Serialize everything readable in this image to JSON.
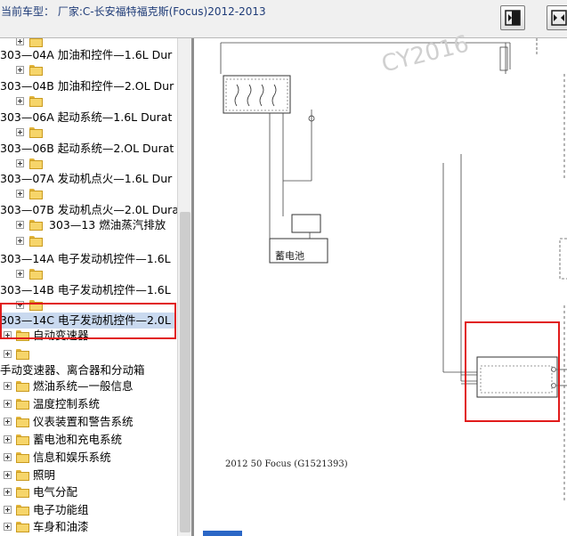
{
  "window": {
    "title": "当前车型：  厂家:C-长安福特福克斯(Focus)2012-2013"
  },
  "toolbar": {
    "buttons": [
      {
        "icon": "panel-right-icon"
      },
      {
        "icon": "panel-expand-icon"
      }
    ]
  },
  "tree": {
    "items": [
      {
        "text": "303—04A 加油和控件—1.6L Dur"
      },
      {
        "text": "303—04B 加油和控件—2.OL Dur"
      },
      {
        "text": "303—06A 起动系统—1.6L Durat"
      },
      {
        "text": "303—06B 起动系统—2.OL Durat"
      },
      {
        "text": "303—07A 发动机点火—1.6L Dur"
      },
      {
        "text": "303—07B 发动机点火—2.0L Dura"
      },
      {
        "text": "303—13 燃油蒸汽排放"
      },
      {
        "text": "303—14A 电子发动机控件—1.6L"
      },
      {
        "text": "303—14B 电子发动机控件—1.6L"
      },
      {
        "text": "303—14C 电子发动机控件—2.0L"
      },
      {
        "text": "自动变速器"
      },
      {
        "text": "手动变速器、离合器和分动箱"
      },
      {
        "text": "燃油系统—一般信息"
      },
      {
        "text": "温度控制系统"
      },
      {
        "text": "仪表装置和警告系统"
      },
      {
        "text": "蓄电池和充电系统"
      },
      {
        "text": "信息和娱乐系统"
      },
      {
        "text": "照明"
      },
      {
        "text": "电气分配"
      },
      {
        "text": "电子功能组"
      },
      {
        "text": "车身和油漆"
      }
    ]
  },
  "diagram": {
    "battery_label": "蓄电池",
    "caption": "2012 50 Focus (G1521393)",
    "watermark": "CY2016"
  },
  "colors": {
    "highlight_border": "#e11b1b",
    "title_text": "#1f3c78",
    "selection_bg": "#c9d9ef"
  }
}
